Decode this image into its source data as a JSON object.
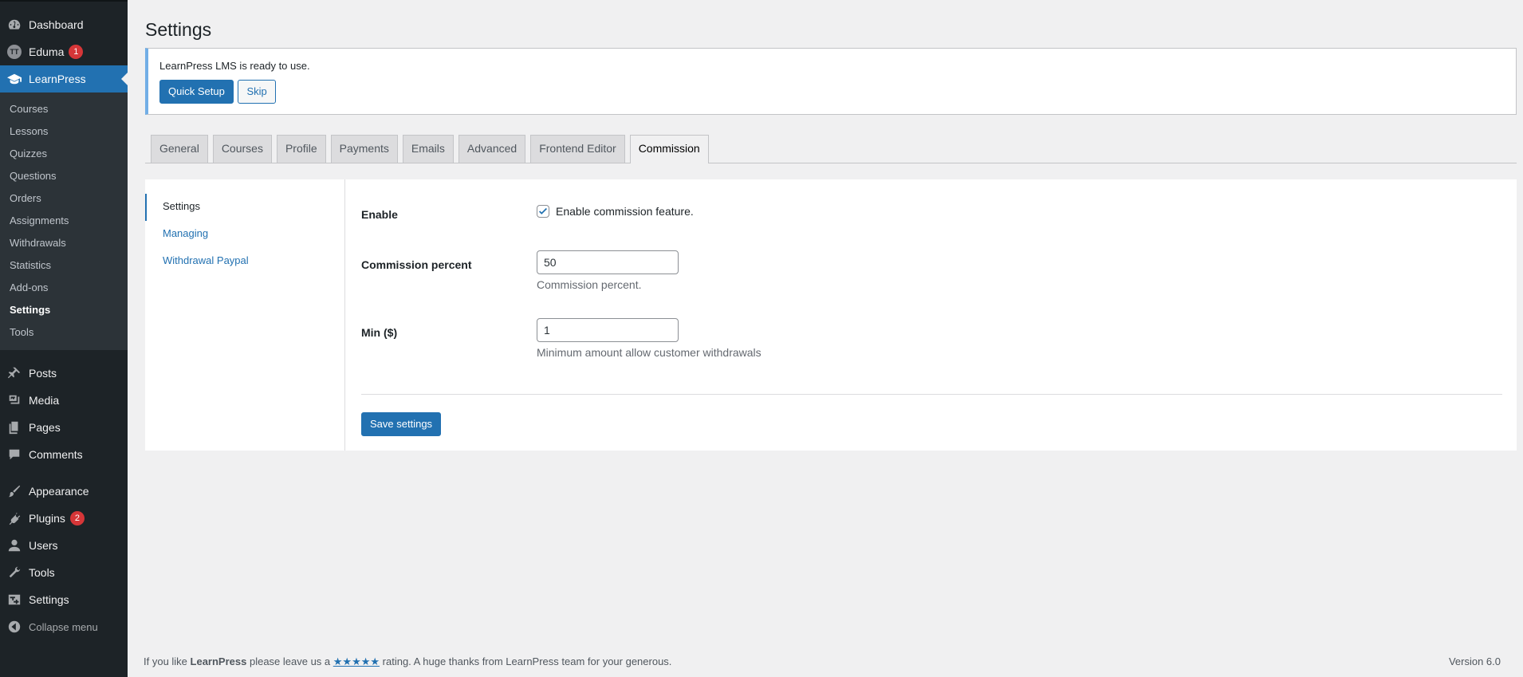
{
  "sidebar": {
    "dashboard": "Dashboard",
    "eduma": "Eduma",
    "eduma_avatar": "TT",
    "eduma_badge": "1",
    "learnpress": "LearnPress",
    "learnpress_sub": [
      "Courses",
      "Lessons",
      "Quizzes",
      "Questions",
      "Orders",
      "Assignments",
      "Withdrawals",
      "Statistics",
      "Add-ons",
      "Settings",
      "Tools"
    ],
    "posts": "Posts",
    "media": "Media",
    "pages": "Pages",
    "comments": "Comments",
    "appearance": "Appearance",
    "plugins": "Plugins",
    "plugins_badge": "2",
    "users": "Users",
    "tools": "Tools",
    "settings": "Settings",
    "collapse": "Collapse menu"
  },
  "page": {
    "title": "Settings"
  },
  "notice": {
    "text": "LearnPress LMS is ready to use.",
    "quick_setup": "Quick Setup",
    "skip": "Skip"
  },
  "tabs": [
    "General",
    "Courses",
    "Profile",
    "Payments",
    "Emails",
    "Advanced",
    "Frontend Editor",
    "Commission"
  ],
  "active_tab": "Commission",
  "subnav": [
    "Settings",
    "Managing",
    "Withdrawal Paypal"
  ],
  "form": {
    "enable_label": "Enable",
    "enable_text": "Enable commission feature.",
    "enable_checked": true,
    "percent_label": "Commission percent",
    "percent_value": "50",
    "percent_desc": "Commission percent.",
    "min_label": "Min ($)",
    "min_value": "1",
    "min_desc": "Minimum amount allow customer withdrawals",
    "save": "Save settings"
  },
  "footer": {
    "pre": "If you like ",
    "brand": "LearnPress",
    "mid": " please leave us a ",
    "stars": "★★★★★",
    "post": " rating. A huge thanks from LearnPress team for your generous.",
    "version": "Version 6.0"
  },
  "colors": {
    "accent": "#2271b1",
    "sidebar": "#1d2327",
    "badge": "#d63638"
  }
}
